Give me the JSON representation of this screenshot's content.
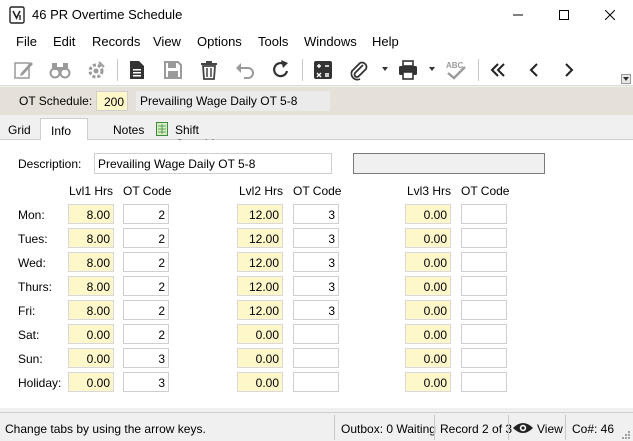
{
  "window": {
    "title": "46 PR Overtime Schedule"
  },
  "menu": [
    "File",
    "Edit",
    "Records",
    "View",
    "Options",
    "Tools",
    "Windows",
    "Help"
  ],
  "toolbar": {
    "icons": [
      "edit-icon",
      "binoculars-icon",
      "settings-gear-icon",
      "document-icon",
      "save-icon",
      "trash-icon",
      "undo-icon",
      "refresh-icon",
      "calculator-icon",
      "paperclip-icon",
      "print-icon",
      "spellcheck-icon",
      "first-record-icon",
      "previous-record-icon",
      "next-record-icon"
    ],
    "spell_label": "ABC"
  },
  "schedule": {
    "label": "OT Schedule:",
    "code": "200",
    "name": "Prevailing Wage Daily OT 5-8"
  },
  "tabs": [
    "Grid",
    "Info",
    "Notes",
    "Shift Overrides"
  ],
  "form": {
    "desc_label": "Description:",
    "description": "Prevailing Wage Daily OT 5-8",
    "headers": {
      "l1": "Lvl1 Hrs",
      "c1": "OT Code",
      "l2": "Lvl2 Hrs",
      "c2": "OT Code",
      "l3": "Lvl3 Hrs",
      "c3": "OT Code"
    },
    "rows": [
      {
        "day": "Mon:",
        "l1": "8.00",
        "c1": "2",
        "l2": "12.00",
        "c2": "3",
        "l3": "0.00",
        "c3": ""
      },
      {
        "day": "Tues:",
        "l1": "8.00",
        "c1": "2",
        "l2": "12.00",
        "c2": "3",
        "l3": "0.00",
        "c3": ""
      },
      {
        "day": "Wed:",
        "l1": "8.00",
        "c1": "2",
        "l2": "12.00",
        "c2": "3",
        "l3": "0.00",
        "c3": ""
      },
      {
        "day": "Thurs:",
        "l1": "8.00",
        "c1": "2",
        "l2": "12.00",
        "c2": "3",
        "l3": "0.00",
        "c3": ""
      },
      {
        "day": "Fri:",
        "l1": "8.00",
        "c1": "2",
        "l2": "12.00",
        "c2": "3",
        "l3": "0.00",
        "c3": ""
      },
      {
        "day": "Sat:",
        "l1": "0.00",
        "c1": "2",
        "l2": "0.00",
        "c2": "",
        "l3": "0.00",
        "c3": ""
      },
      {
        "day": "Sun:",
        "l1": "0.00",
        "c1": "3",
        "l2": "0.00",
        "c2": "",
        "l3": "0.00",
        "c3": ""
      },
      {
        "day": "Holiday:",
        "l1": "0.00",
        "c1": "3",
        "l2": "0.00",
        "c2": "",
        "l3": "0.00",
        "c3": ""
      }
    ]
  },
  "status": {
    "hint": "Change tabs by using the arrow keys.",
    "outbox": "Outbox: 0 Waiting",
    "record": "Record 2 of 3",
    "view": "View",
    "company": "Co#: 46"
  },
  "colors": {
    "input_yellow": "#fdf7c9",
    "schedule_bar": "#e6e1d8"
  }
}
